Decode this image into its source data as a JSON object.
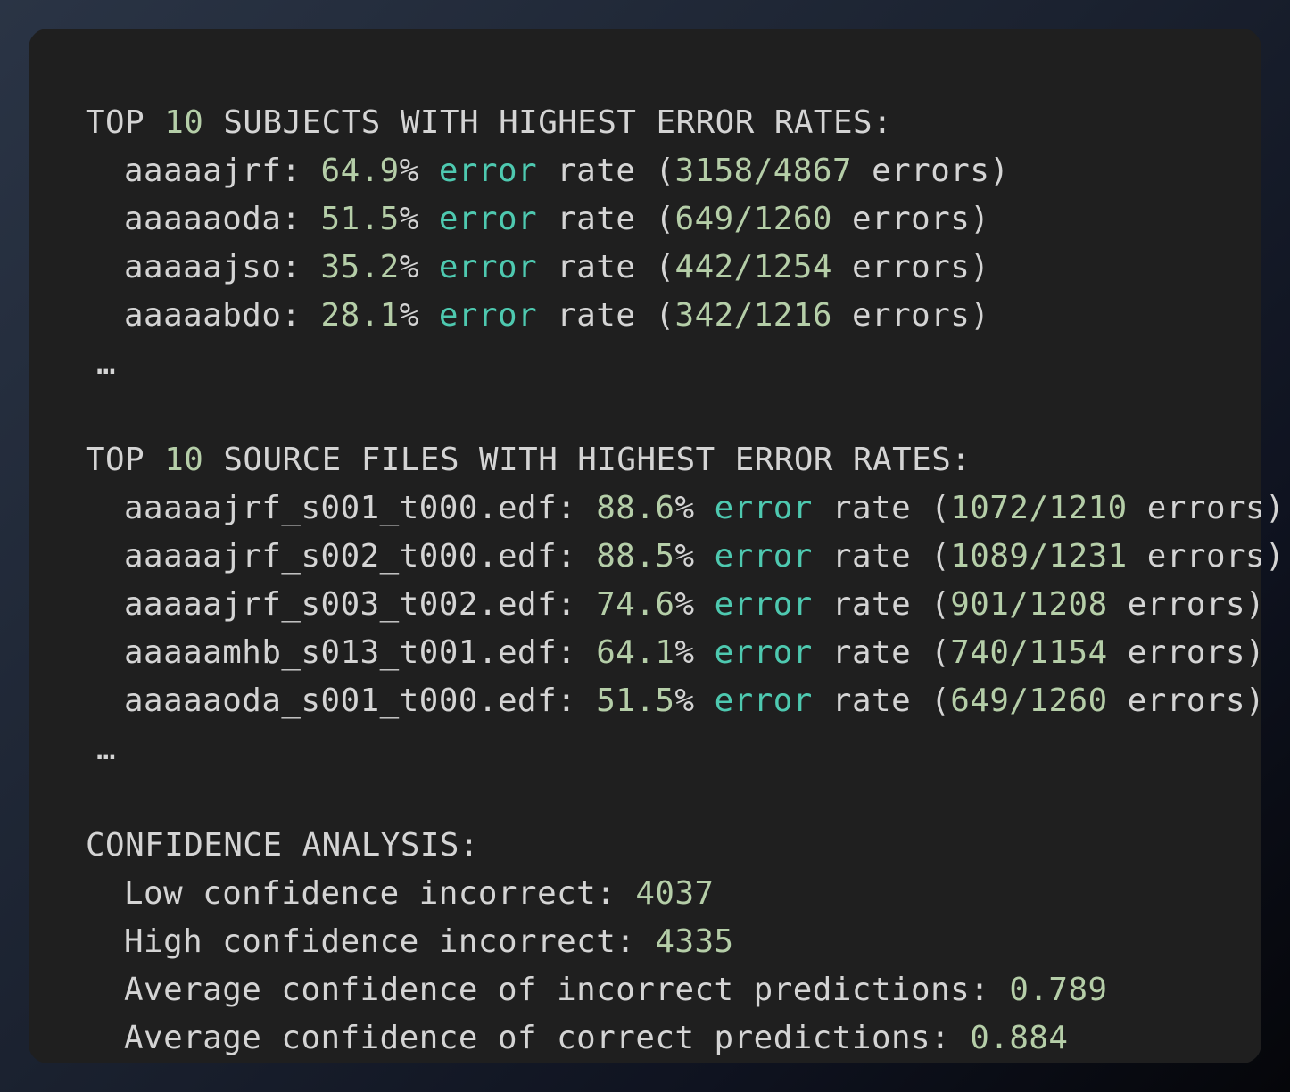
{
  "subjects_section": {
    "heading_pre": "TOP ",
    "heading_num": "10",
    "heading_post": " SUBJECTS WITH HIGHEST ERROR RATES:",
    "rows": [
      {
        "name": "aaaaajrf",
        "pct": "64.9",
        "errors": "3158",
        "total": "4867"
      },
      {
        "name": "aaaaaoda",
        "pct": "51.5",
        "errors": "649",
        "total": "1260"
      },
      {
        "name": "aaaaajso",
        "pct": "35.2",
        "errors": "442",
        "total": "1254"
      },
      {
        "name": "aaaaabdo",
        "pct": "28.1",
        "errors": "342",
        "total": "1216"
      }
    ],
    "ellipsis": "…"
  },
  "files_section": {
    "heading_pre": "TOP ",
    "heading_num": "10",
    "heading_post": " SOURCE FILES WITH HIGHEST ERROR RATES:",
    "rows": [
      {
        "name": "aaaaajrf_s001_t000.edf",
        "pct": "88.6",
        "errors": "1072",
        "total": "1210"
      },
      {
        "name": "aaaaajrf_s002_t000.edf",
        "pct": "88.5",
        "errors": "1089",
        "total": "1231"
      },
      {
        "name": "aaaaajrf_s003_t002.edf",
        "pct": "74.6",
        "errors": "901",
        "total": "1208"
      },
      {
        "name": "aaaaamhb_s013_t001.edf",
        "pct": "64.1",
        "errors": "740",
        "total": "1154"
      },
      {
        "name": "aaaaaoda_s001_t000.edf",
        "pct": "51.5",
        "errors": "649",
        "total": "1260"
      }
    ],
    "ellipsis": "…"
  },
  "row_text": {
    "colon": ": ",
    "percent": "%",
    "error_word": "error",
    "rate_open": " rate (",
    "slash": "/",
    "errors_close": " errors)"
  },
  "confidence_section": {
    "heading": "CONFIDENCE ANALYSIS:",
    "items": [
      {
        "label": "Low confidence incorrect: ",
        "value": "4037"
      },
      {
        "label": "High confidence incorrect: ",
        "value": "4335"
      },
      {
        "label": "Average confidence of incorrect predictions: ",
        "value": "0.789"
      },
      {
        "label": "Average confidence of correct predictions: ",
        "value": "0.884"
      }
    ]
  },
  "colors": {
    "background": "#1f1f1f",
    "text": "#d4d4d4",
    "number": "#b5cea8",
    "keyword": "#4ec9b0"
  }
}
